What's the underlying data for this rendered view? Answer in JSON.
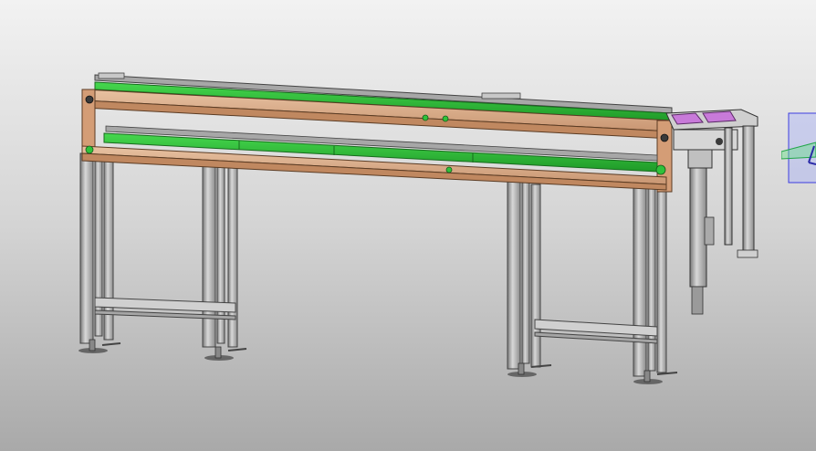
{
  "viewport": {
    "background_top": "#f2f2f2",
    "background_mid": "#d4d4d4",
    "background_bottom": "#a9a9a9"
  },
  "colors": {
    "frame_wood": "#d8a882",
    "frame_wood_dark": "#b98460",
    "belt_green": "#2fc23a",
    "belt_green_dark": "#1c8e24",
    "steel": "#bdbdbd",
    "steel_dark": "#6e6e6e",
    "part_magenta": "#c87ad9",
    "plane_blue": "#6d6df0",
    "plane_green": "#34c85a"
  },
  "model": {
    "name_icon": "conveyor-assembly-3d-model",
    "leg_icons": [
      "leg-foot-icon",
      "leg-foot-icon",
      "leg-foot-icon",
      "leg-foot-icon"
    ],
    "view_triad_icon": "reference-plane-triad-icon"
  }
}
